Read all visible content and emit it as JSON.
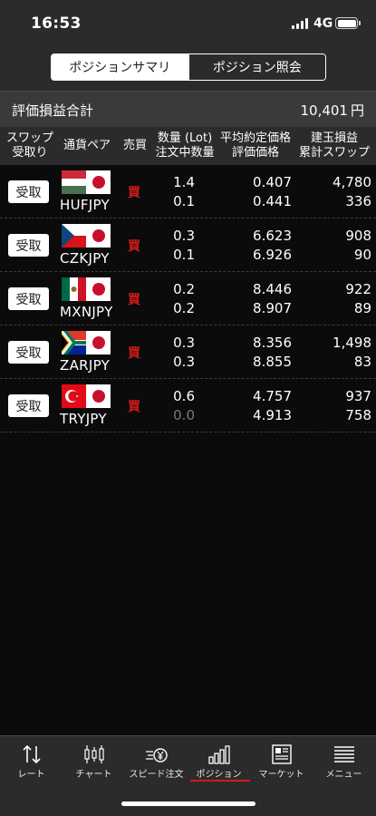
{
  "status_bar": {
    "time": "16:53",
    "network": "4G"
  },
  "segment": {
    "tabs": [
      "ポジションサマリ",
      "ポジション照会"
    ],
    "active_index": 0
  },
  "total": {
    "label": "評価損益合計",
    "value": "10,401",
    "unit": "円"
  },
  "table_header": {
    "swap_receive": [
      "スワップ",
      "受取り"
    ],
    "pair": "通貨ペア",
    "side": "売買",
    "quantity": [
      "数量 (Lot)",
      "注文中数量"
    ],
    "price": [
      "平均約定価格",
      "評価価格"
    ],
    "pl": [
      "建玉損益",
      "累計スワップ"
    ]
  },
  "rows": [
    {
      "button": "受取",
      "pair": "HUFJPY",
      "side": "買",
      "qty": "1.4",
      "order_qty": "0.1",
      "avg_price": "0.407",
      "eval_price": "0.441",
      "pl": "4,780",
      "swap": "336"
    },
    {
      "button": "受取",
      "pair": "CZKJPY",
      "side": "買",
      "qty": "0.3",
      "order_qty": "0.1",
      "avg_price": "6.623",
      "eval_price": "6.926",
      "pl": "908",
      "swap": "90"
    },
    {
      "button": "受取",
      "pair": "MXNJPY",
      "side": "買",
      "qty": "0.2",
      "order_qty": "0.2",
      "avg_price": "8.446",
      "eval_price": "8.907",
      "pl": "922",
      "swap": "89"
    },
    {
      "button": "受取",
      "pair": "ZARJPY",
      "side": "買",
      "qty": "0.3",
      "order_qty": "0.3",
      "avg_price": "8.356",
      "eval_price": "8.855",
      "pl": "1,498",
      "swap": "83"
    },
    {
      "button": "受取",
      "pair": "TRYJPY",
      "side": "買",
      "qty": "0.6",
      "order_qty": "0.0",
      "avg_price": "4.757",
      "eval_price": "4.913",
      "pl": "937",
      "swap": "758"
    }
  ],
  "colors": {
    "buy": "#d11a1a",
    "background": "#0b0b0b",
    "bar": "#2b2b2b",
    "accent": "#d11a1a"
  },
  "tab_bar": {
    "items": [
      {
        "label": "レート",
        "icon": "arrows-updown-icon"
      },
      {
        "label": "チャート",
        "icon": "candlestick-icon"
      },
      {
        "label": "スピード注文",
        "icon": "speed-yen-icon"
      },
      {
        "label": "ポジション",
        "icon": "bar-chart-icon"
      },
      {
        "label": "マーケット",
        "icon": "newspaper-icon"
      },
      {
        "label": "メニュー",
        "icon": "menu-list-icon"
      }
    ],
    "active_index": 3
  }
}
